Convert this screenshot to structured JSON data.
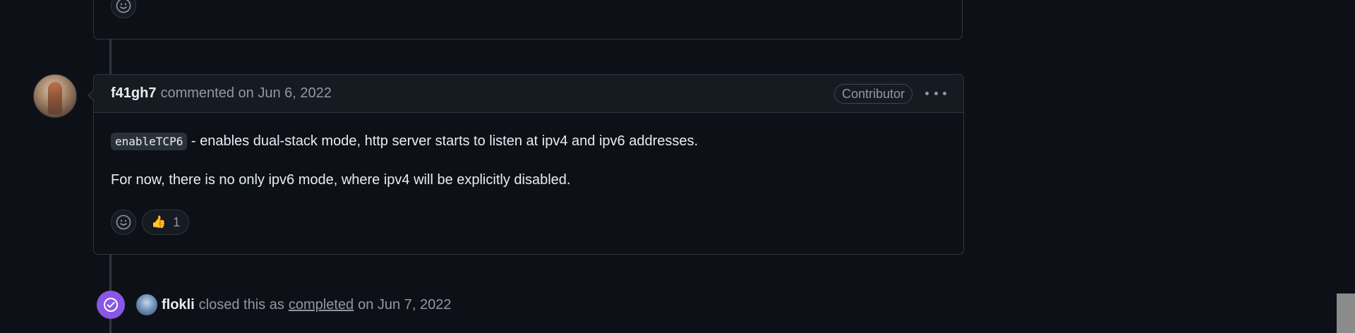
{
  "comment": {
    "author": "f41gh7",
    "action_text": "commented on Jun 6, 2022",
    "role_badge": "Contributor",
    "code_snippet": "enableTCP6",
    "paragraph1_rest": " - enables dual-stack mode, http server starts to listen at ipv4 and ipv6 addresses.",
    "paragraph2": "For now, there is no only ipv6 mode, where ipv4 will be explicitly disabled.",
    "reactions": [
      {
        "emoji": "👍",
        "count": "1"
      }
    ]
  },
  "event": {
    "actor": "flokli",
    "text1": "closed this as",
    "link": "completed",
    "text2": "on Jun 7, 2022"
  },
  "icons": {
    "smiley": "smiley-icon",
    "kebab": "kebab-horizontal-icon",
    "closed": "check-circle-icon"
  },
  "colors": {
    "background": "#0d1117",
    "closed_accent": "#8957e5"
  }
}
